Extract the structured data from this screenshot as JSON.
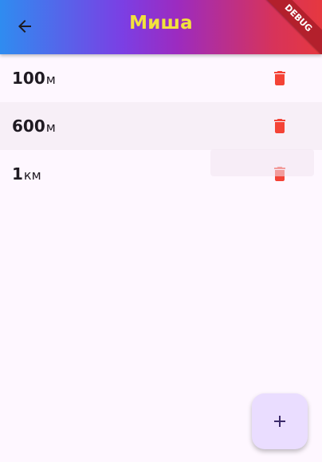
{
  "appbar": {
    "title": "Миша",
    "back_icon": "arrow-back-icon",
    "title_color": "#f2e23c"
  },
  "debug_banner": {
    "label": "DEBUG"
  },
  "distances": [
    {
      "value": "100",
      "unit": "м"
    },
    {
      "value": "600",
      "unit": "м"
    },
    {
      "value": "1",
      "unit": "км"
    }
  ],
  "delete_icon": "trash-icon",
  "delete_color": "#f44336",
  "fab": {
    "icon": "plus-icon"
  }
}
